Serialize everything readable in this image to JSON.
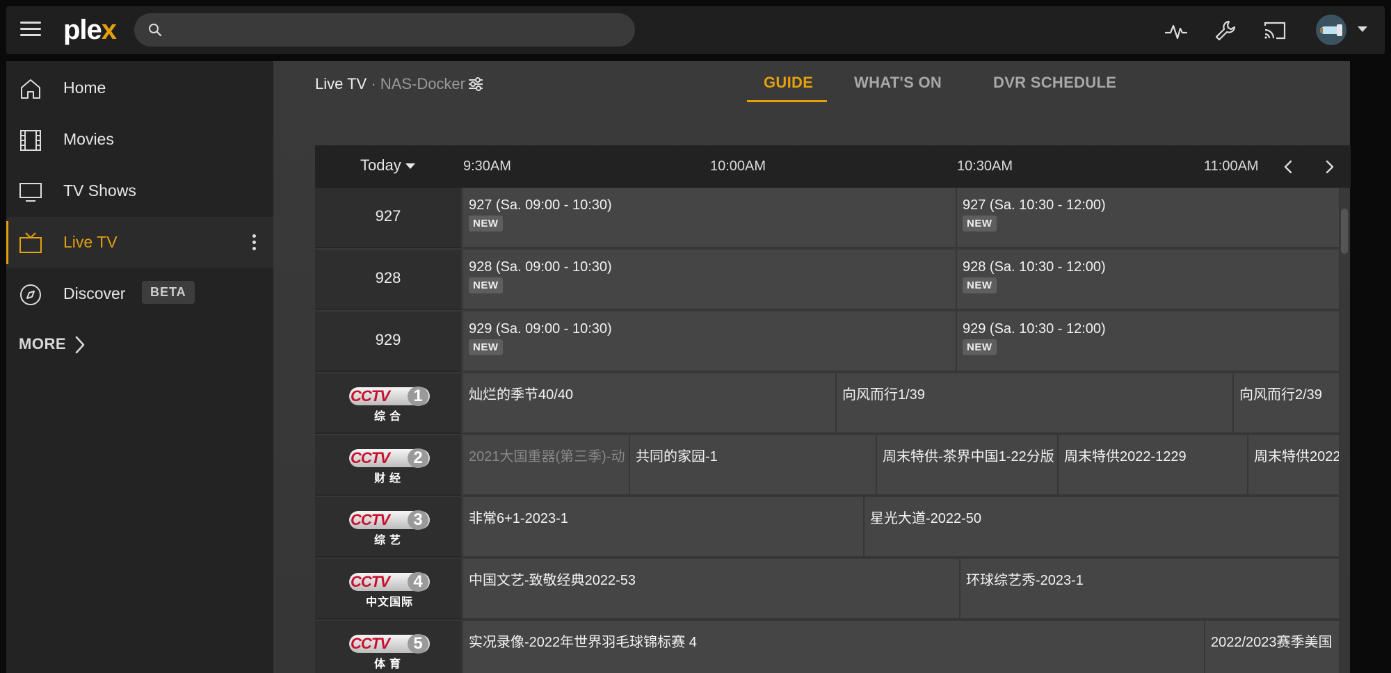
{
  "app": {
    "logo_text": "plex",
    "accent": "#e5a00d"
  },
  "search": {
    "placeholder": ""
  },
  "topbar": {
    "icons": [
      "activity-icon",
      "settings-wrench-icon",
      "cast-icon"
    ],
    "avatar": "user-avatar"
  },
  "sidebar": {
    "items": [
      {
        "label": "Home",
        "icon": "home-icon"
      },
      {
        "label": "Movies",
        "icon": "film-icon"
      },
      {
        "label": "TV Shows",
        "icon": "monitor-icon"
      },
      {
        "label": "Live TV",
        "icon": "tv-icon",
        "active": true
      },
      {
        "label": "Discover",
        "icon": "compass-icon",
        "badge": "BETA"
      }
    ],
    "more_label": "MORE"
  },
  "header": {
    "section": "Live TV",
    "server": "· NAS-Docker"
  },
  "tabs": [
    {
      "label": "GUIDE",
      "active": true
    },
    {
      "label": "WHAT'S ON",
      "active": false
    },
    {
      "label": "DVR SCHEDULE",
      "active": false
    }
  ],
  "guide": {
    "day_label": "Today",
    "times": [
      "9:30AM",
      "10:00AM",
      "10:30AM",
      "11:00AM"
    ],
    "channels": [
      {
        "type": "number",
        "label": "927"
      },
      {
        "type": "number",
        "label": "928"
      },
      {
        "type": "number",
        "label": "929"
      },
      {
        "type": "cctv",
        "logo": "CCTV",
        "num": "1",
        "sub": "综合"
      },
      {
        "type": "cctv",
        "logo": "CCTV",
        "num": "2",
        "sub": "财经"
      },
      {
        "type": "cctv",
        "logo": "CCTV",
        "num": "3",
        "sub": "综艺"
      },
      {
        "type": "cctv",
        "logo": "CCTV",
        "num": "4",
        "sub": "中文国际"
      },
      {
        "type": "cctv",
        "logo": "CCTV",
        "num": "5",
        "sub": "体育"
      }
    ],
    "new_badge": "NEW",
    "rows": [
      [
        {
          "title": "927 (Sa. 09:00 - 10:30)",
          "new": true
        },
        {
          "title": "927 (Sa. 10:30 - 12:00)",
          "new": true
        }
      ],
      [
        {
          "title": "928 (Sa. 09:00 - 10:30)",
          "new": true
        },
        {
          "title": "928 (Sa. 10:30 - 12:00)",
          "new": true
        }
      ],
      [
        {
          "title": "929 (Sa. 09:00 - 10:30)",
          "new": true
        },
        {
          "title": "929 (Sa. 10:30 - 12:00)",
          "new": true
        }
      ],
      [
        {
          "title": "灿烂的季节40/40"
        },
        {
          "title": "向风而行1/39"
        },
        {
          "title": "向风而行2/39"
        }
      ],
      [
        {
          "title": "2021大国重器(第三季)-动",
          "past": true
        },
        {
          "title": "共同的家园-1"
        },
        {
          "title": "周末特供-茶界中国1-22分版"
        },
        {
          "title": "周末特供2022-1229"
        },
        {
          "title": "周末特供2022"
        }
      ],
      [
        {
          "title": "非常6+1-2023-1"
        },
        {
          "title": "星光大道-2022-50"
        }
      ],
      [
        {
          "title": "中国文艺-致敬经典2022-53"
        },
        {
          "title": "环球综艺秀-2023-1"
        }
      ],
      [
        {
          "title": "实况录像-2022年世界羽毛球锦标赛 4"
        },
        {
          "title": "2022/2023赛季美国"
        }
      ]
    ]
  }
}
